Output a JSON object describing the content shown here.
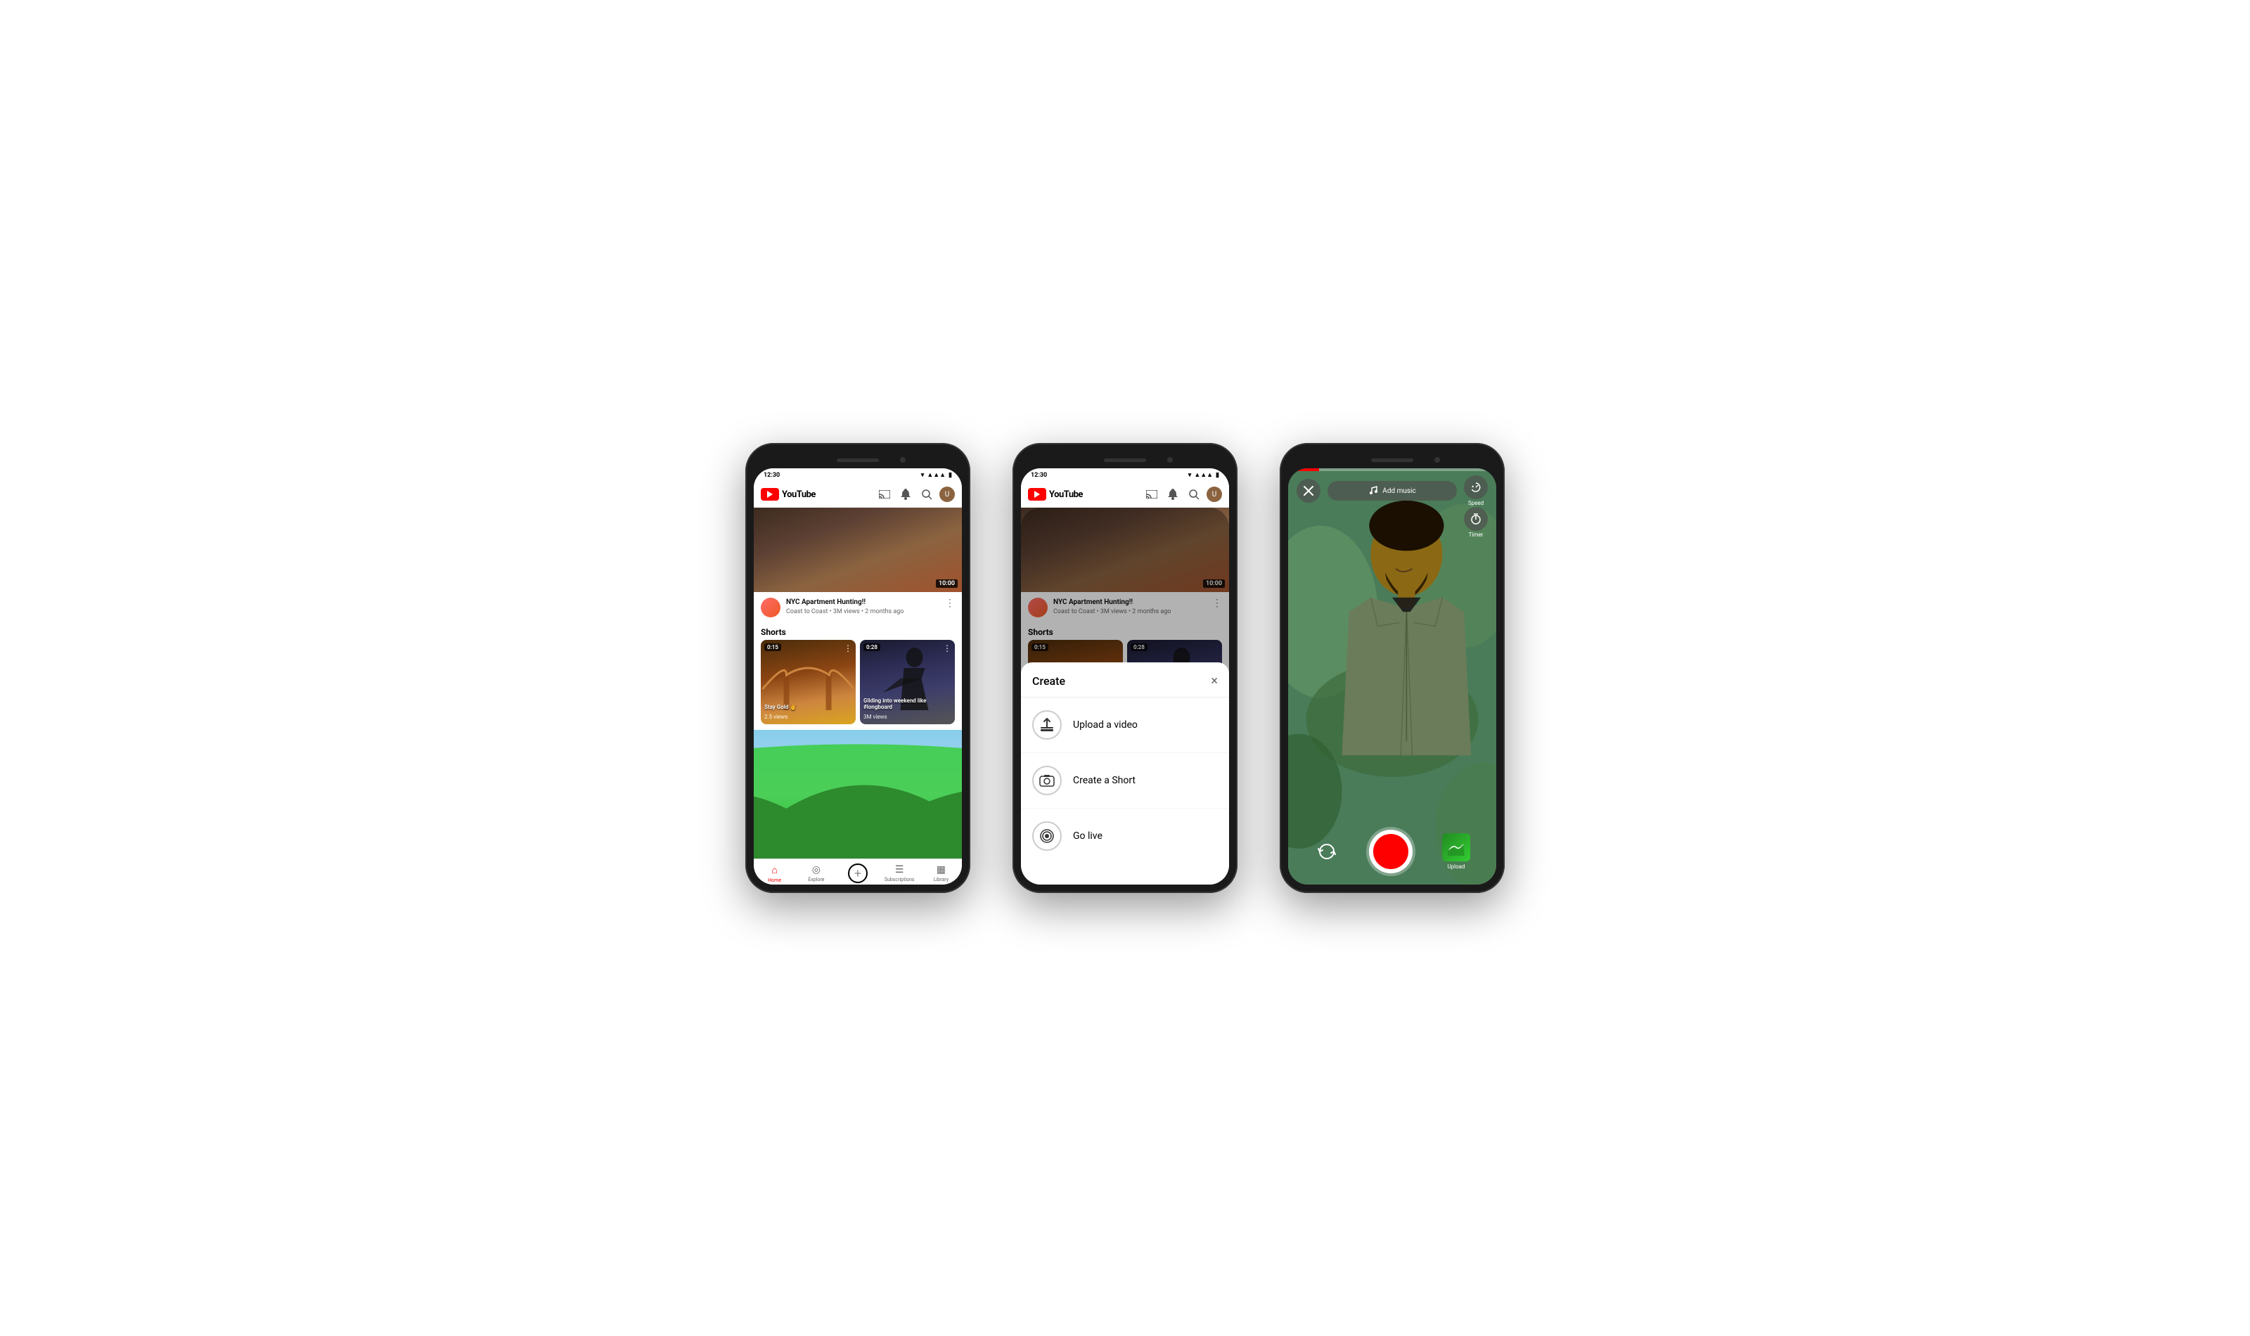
{
  "phone1": {
    "status_time": "12:30",
    "header": {
      "logo_text": "YouTube",
      "cast_icon": "📡",
      "bell_icon": "🔔",
      "search_icon": "🔍"
    },
    "featured_video": {
      "duration": "10:00",
      "title": "NYC Apartment Hunting!!",
      "meta": "Coast to Coast • 3M views • 2 months ago"
    },
    "shorts_section": {
      "label": "Shorts",
      "items": [
        {
          "duration": "0:15",
          "title": "Stay Gold ✌",
          "views": "2.5 views"
        },
        {
          "duration": "0:28",
          "title": "Gliding into weekend like #longboard",
          "views": "3M views"
        }
      ]
    },
    "bottom_nav": {
      "items": [
        {
          "label": "Home",
          "active": true
        },
        {
          "label": "Explore",
          "active": false
        },
        {
          "label": "",
          "active": false
        },
        {
          "label": "Subscriptions",
          "active": false
        },
        {
          "label": "Library",
          "active": false
        }
      ]
    }
  },
  "phone2": {
    "status_time": "12:30",
    "featured_video": {
      "duration": "10:00",
      "title": "NYC Apartment Hunting!!",
      "meta": "Coast to Coast • 3M views • 2 months ago"
    },
    "shorts_section": {
      "label": "Shorts",
      "items": [
        {
          "duration": "0:15"
        },
        {
          "duration": "0:28"
        }
      ]
    },
    "create_modal": {
      "title": "Create",
      "close_label": "×",
      "options": [
        {
          "label": "Upload a video",
          "icon": "upload"
        },
        {
          "label": "Create a Short",
          "icon": "camera"
        },
        {
          "label": "Go live",
          "icon": "live"
        }
      ]
    }
  },
  "phone3": {
    "top_bar": {
      "close_label": "×",
      "music_label": "Add music",
      "speed_label": "Speed",
      "timer_label": "Timer"
    },
    "bottom_bar": {
      "upload_label": "Upload"
    }
  }
}
